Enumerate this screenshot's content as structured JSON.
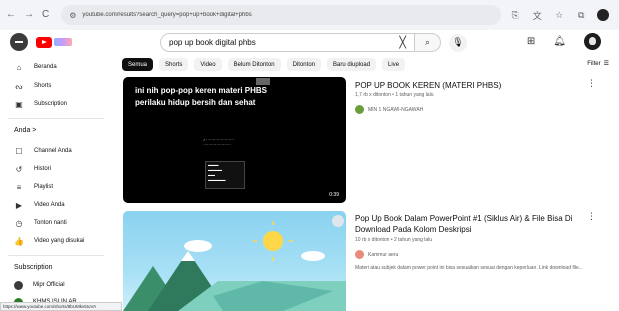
{
  "browser": {
    "url": "youtube.com/results?search_query=pop+up+book+digital+phbs",
    "back": "←",
    "forward": "→",
    "reload": "C"
  },
  "header": {
    "search_value": "pop up book digital phbs",
    "clear": "╳",
    "search_icon": "⌕",
    "mic": "🎙"
  },
  "sidebar": {
    "items": [
      {
        "label": "Beranda",
        "icon": "⌂"
      },
      {
        "label": "Shorts",
        "icon": "ᔓ"
      },
      {
        "label": "Subscription",
        "icon": "▣"
      }
    ],
    "you_heading": "Anda  >",
    "you_items": [
      {
        "label": "Channel Anda",
        "icon": "☐"
      },
      {
        "label": "Histori",
        "icon": "↺"
      },
      {
        "label": "Playlist",
        "icon": "≡"
      },
      {
        "label": "Video Anda",
        "icon": "▶"
      },
      {
        "label": "Tonton nanti",
        "icon": "◷"
      },
      {
        "label": "Video yang disukai",
        "icon": "👍"
      }
    ],
    "subs_heading": "Subscription",
    "subs": [
      {
        "label": "Mipr Official",
        "color": "#3b3b3b"
      },
      {
        "label": "KHMS ISLIN AR ..",
        "color": "#2d7a2d"
      }
    ]
  },
  "chips": [
    "Semua",
    "Shorts",
    "Video",
    "Belum Ditonton",
    "Ditonton",
    "Baru diupload",
    "Live"
  ],
  "filter_label": "Filter",
  "results": [
    {
      "title": "POP UP BOOK KEREN (MATERI PHBS)",
      "meta": "1,7 rb x ditonton • 1 tahun yang lalu",
      "channel": "MIN 1 NGAWI-NGAWAH",
      "thumb_text": "ini nih pop-pop keren materi PHBS perilaku hidup bersih dan sehat",
      "duration": "0:39"
    },
    {
      "title": "Pop Up Book Dalam PowerPoint #1 (Siklus Air) & File Bisa Di Download Pada Kolom Deskripsi",
      "meta": "10 rb x ditonton • 2 tahun yang lalu",
      "channel": "Kammur aeru",
      "desc": "Materi atau subjek dalam power point ini bisa sesuaikan sesuai dengan keperluan. Link download file..."
    }
  ],
  "status_url": "https://www.youtube.com/shorts/8bUMkv5IuVA",
  "colors": {
    "accent": "#ff0000",
    "chip_active": "#0f0f0f"
  }
}
